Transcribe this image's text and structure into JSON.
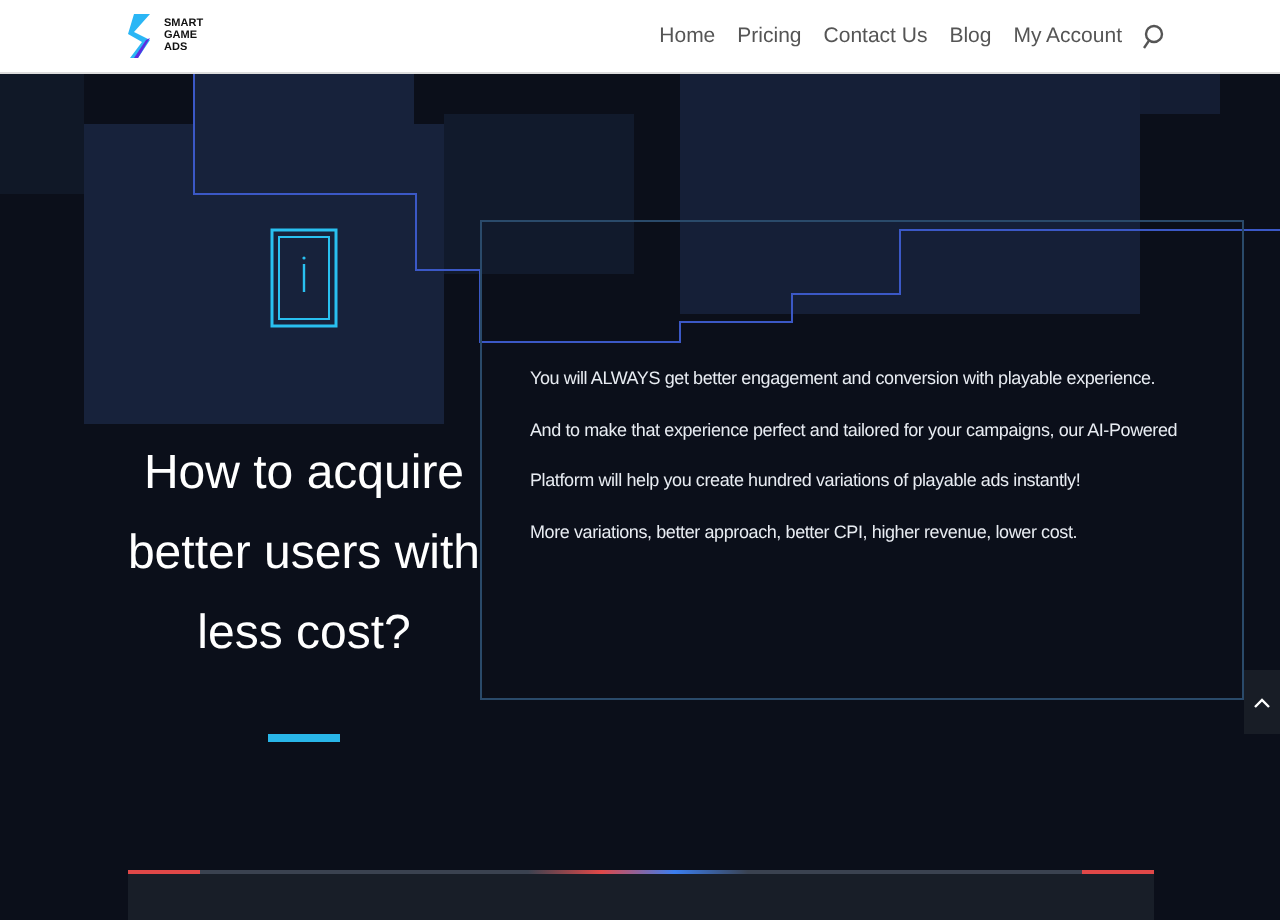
{
  "header": {
    "logo_lines": [
      "SMART",
      "GAME",
      "ADS"
    ],
    "nav": [
      {
        "label": "Home",
        "selected": false
      },
      {
        "label": "Pricing",
        "selected": false
      },
      {
        "label": "Contact Us",
        "selected": false
      },
      {
        "label": "Blog",
        "selected": false
      },
      {
        "label": "My Account",
        "selected": false
      }
    ]
  },
  "hero": {
    "heading": "How to acquire better users with less cost?",
    "paragraphs": [
      "You will ALWAYS get better engagement and conversion with playable experience.",
      "And to make that experience perfect and tailored for your campaigns, our AI-Powered Platform will help you create hundred variations of playable ads instantly!",
      "More variations, better approach, better CPI, higher revenue, lower cost."
    ]
  }
}
